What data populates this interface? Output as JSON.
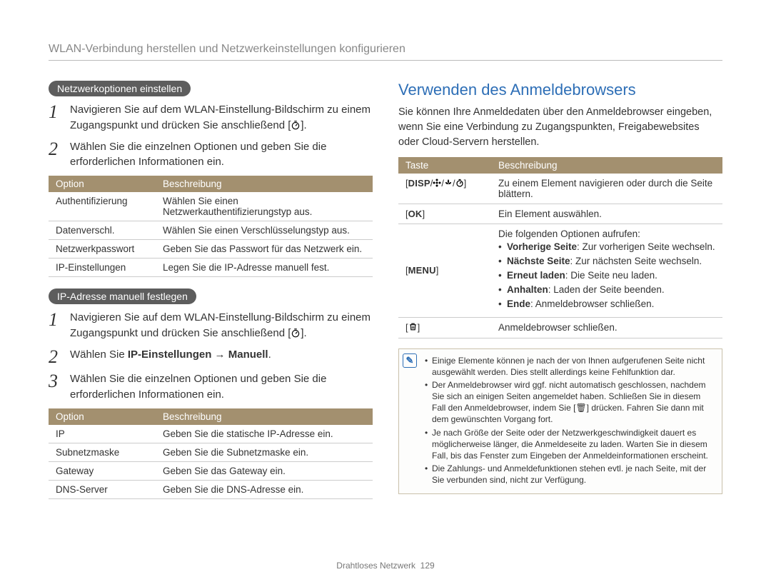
{
  "header": {
    "title": "WLAN-Verbindung herstellen und Netzwerkeinstellungen konfigurieren"
  },
  "left": {
    "pill1": "Netzwerkoptionen einstellen",
    "steps1": [
      {
        "num": "1",
        "text_before": "Navigieren Sie auf dem WLAN-Einstellung-Bildschirm zu einem Zugangspunkt und drücken Sie anschließend [",
        "text_after": "]."
      },
      {
        "num": "2",
        "text": "Wählen Sie die einzelnen Optionen und geben Sie die erforderlichen Informationen ein."
      }
    ],
    "table1": {
      "headers": [
        "Option",
        "Beschreibung"
      ],
      "rows": [
        [
          "Authentifizierung",
          "Wählen Sie einen Netzwerkauthentifizierungstyp aus."
        ],
        [
          "Datenverschl.",
          "Wählen Sie einen Verschlüsselungstyp aus."
        ],
        [
          "Netzwerkpasswort",
          "Geben Sie das Passwort für das Netzwerk ein."
        ],
        [
          "IP-Einstellungen",
          "Legen Sie die IP-Adresse manuell fest."
        ]
      ]
    },
    "pill2": "IP-Adresse manuell festlegen",
    "steps2": [
      {
        "num": "1",
        "text_before": "Navigieren Sie auf dem WLAN-Einstellung-Bildschirm zu einem Zugangspunkt und drücken Sie anschließend [",
        "text_after": "]."
      },
      {
        "num": "2",
        "prefix": "Wählen Sie ",
        "bold1": "IP-Einstellungen",
        "arrow": " → ",
        "bold2": "Manuell",
        "suffix": "."
      },
      {
        "num": "3",
        "text": "Wählen Sie die einzelnen Optionen und geben Sie die erforderlichen Informationen ein."
      }
    ],
    "table2": {
      "headers": [
        "Option",
        "Beschreibung"
      ],
      "rows": [
        [
          "IP",
          "Geben Sie die statische IP-Adresse ein."
        ],
        [
          "Subnetzmaske",
          "Geben Sie die Subnetzmaske ein."
        ],
        [
          "Gateway",
          "Geben Sie das Gateway ein."
        ],
        [
          "DNS-Server",
          "Geben Sie die DNS-Adresse ein."
        ]
      ]
    }
  },
  "right": {
    "title": "Verwenden des Anmeldebrowsers",
    "intro": "Sie können Ihre Anmeldedaten über den Anmeldebrowser eingeben, wenn Sie eine Verbindung zu Zugangspunkten, Freigabewebsites oder Cloud-Servern herstellen.",
    "table": {
      "headers": [
        "Taste",
        "Beschreibung"
      ],
      "rows": [
        {
          "key_type": "disp",
          "desc": "Zu einem Element navigieren oder durch die Seite blättern."
        },
        {
          "key_type": "ok",
          "key_label": "OK",
          "desc": "Ein Element auswählen."
        },
        {
          "key_type": "menu",
          "key_label": "MENU",
          "desc_header": "Die folgenden Optionen aufrufen:",
          "bullets": [
            {
              "b": "Vorherige Seite",
              "t": ": Zur vorherigen Seite wechseln."
            },
            {
              "b": "Nächste Seite",
              "t": ": Zur nächsten Seite wechseln."
            },
            {
              "b": "Erneut laden",
              "t": ": Die Seite neu laden."
            },
            {
              "b": "Anhalten",
              "t": ": Laden der Seite beenden."
            },
            {
              "b": "Ende",
              "t": ": Anmeldebrowser schließen."
            }
          ]
        },
        {
          "key_type": "trash",
          "desc": "Anmeldebrowser schließen."
        }
      ]
    },
    "note": {
      "items": [
        "Einige Elemente können je nach der von Ihnen aufgerufenen Seite nicht ausgewählt werden. Dies stellt allerdings keine Fehlfunktion dar.",
        "Der Anmeldebrowser wird ggf. nicht automatisch geschlossen, nachdem Sie sich an einigen Seiten angemeldet haben. Schließen Sie in diesem Fall den Anmeldebrowser, indem Sie [🗑] drücken. Fahren Sie dann mit dem gewünschten Vorgang fort.",
        "Je nach Größe der Seite oder der Netzwerkgeschwindigkeit dauert es möglicherweise länger, die Anmeldeseite zu laden. Warten Sie in diesem Fall, bis das Fenster zum Eingeben der Anmeldeinformationen erscheint.",
        "Die Zahlungs- und Anmeldefunktionen stehen evtl. je nach Seite, mit der Sie verbunden sind, nicht zur Verfügung."
      ]
    }
  },
  "footer": {
    "section": "Drahtloses Netzwerk",
    "page": "129"
  },
  "icons": {
    "timer": "timer-icon",
    "flower": "flower-icon",
    "macro": "macro-icon",
    "trash": "trash-icon"
  }
}
